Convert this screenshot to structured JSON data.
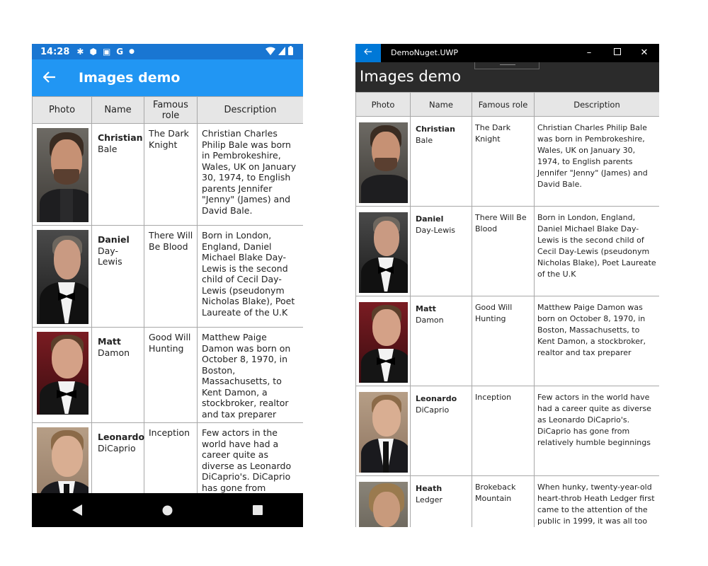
{
  "android": {
    "status": {
      "time": "14:28"
    },
    "title": "Images demo"
  },
  "uwp": {
    "window_title": "DemoNuget.UWP",
    "title": "Images demo"
  },
  "table": {
    "headers": {
      "photo": "Photo",
      "name": "Name",
      "role": "Famous role",
      "description": "Description"
    },
    "rows": [
      {
        "first": "Christian",
        "last": "Bale",
        "role": "The Dark Knight",
        "description": "Christian Charles Philip Bale was born in Pembrokeshire, Wales, UK on January 30, 1974, to English parents Jennifer \"Jenny\" (James) and David Bale."
      },
      {
        "first": "Daniel",
        "last": "Day-Lewis",
        "role": "There Will Be Blood",
        "description": "Born in London, England, Daniel Michael Blake Day-Lewis is the second child of Cecil Day-Lewis (pseudonym Nicholas Blake), Poet Laureate of the U.K"
      },
      {
        "first": "Matt",
        "last": "Damon",
        "role": "Good Will Hunting",
        "description": "Matthew Paige Damon was born on October 8, 1970, in Boston, Massachusetts, to Kent Damon, a stockbroker, realtor and tax preparer"
      },
      {
        "first": "Leonardo",
        "last": "DiCaprio",
        "role": "Inception",
        "description": "Few actors in the world have had a career quite as diverse as Leonardo DiCaprio's. DiCaprio has gone from relatively humble beginnings"
      },
      {
        "first": "Heath",
        "last": "Ledger",
        "role": "Brokeback Mountain",
        "description": "When hunky, twenty-year-old heart-throb Heath Ledger first came to the attention of the public in 1999, it was all too easy to tag him."
      }
    ]
  },
  "icons": {
    "back": "arrow-left-icon",
    "gear": "gear-icon",
    "shield": "shield-icon",
    "google": "google-g-icon",
    "wifi": "wifi-icon",
    "signal": "signal-icon",
    "battery": "battery-icon",
    "nav_back": "nav-back-icon",
    "nav_home": "nav-home-icon",
    "nav_recents": "nav-recents-icon",
    "minimize": "minimize-icon",
    "maximize": "maximize-icon",
    "close": "close-icon"
  },
  "colors": {
    "android_status": "#1976d2",
    "android_appbar": "#2196f3",
    "uwp_titlebar": "#000000",
    "uwp_back": "#0078d7",
    "uwp_header": "#2b2b2b",
    "table_header": "#e6e6e6",
    "grid_border": "#a8a8a8"
  }
}
